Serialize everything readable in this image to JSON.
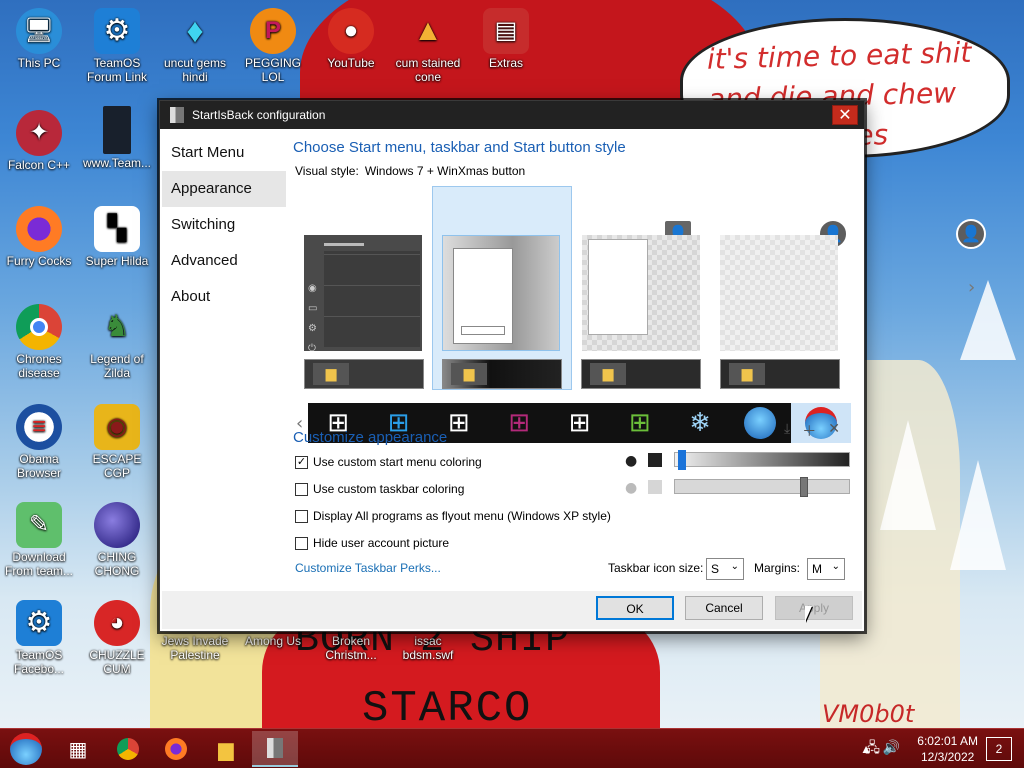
{
  "desktop": {
    "background_text": {
      "bubble": "it's time to eat shit and die and chew",
      "bubble_tail": "mes",
      "shirt_line1": "BORN 2 SHIP",
      "shirt_line2": "STARCO",
      "signature": "VM0b0t"
    },
    "icons": [
      {
        "label": "This PC",
        "icon": "computer-icon"
      },
      {
        "label": "TeamOS Forum Link",
        "icon": "gear-icon"
      },
      {
        "label": "uncut gems hindi",
        "icon": "diamond-icon"
      },
      {
        "label": "PEGGING LOL",
        "icon": "peggle-icon"
      },
      {
        "label": "YouTube",
        "icon": "angry-bird-icon"
      },
      {
        "label": "cum stained cone",
        "icon": "cone-icon"
      },
      {
        "label": "Extras",
        "icon": "archive-icon"
      },
      {
        "label": "Falcon C++",
        "icon": "falcon-icon"
      },
      {
        "label": "www.Team...",
        "icon": "document-icon"
      },
      {
        "label": "Furry Cocks",
        "icon": "firefox-icon"
      },
      {
        "label": "Super Hilda",
        "icon": "pixel-dog-icon"
      },
      {
        "label": "Chrones disease",
        "icon": "chrome-icon"
      },
      {
        "label": "Legend of Zilda",
        "icon": "link-sprite-icon"
      },
      {
        "label": "Obama Browser",
        "icon": "obama-logo-icon"
      },
      {
        "label": "ESCAPE CGP",
        "icon": "mahjong-icon"
      },
      {
        "label": "Download From team...",
        "icon": "notepad-icon"
      },
      {
        "label": "CHING CHONG",
        "icon": "bomb-icon"
      },
      {
        "label": "TeamOS Facebo...",
        "icon": "gear-icon"
      },
      {
        "label": "CHUZZLE CUM",
        "icon": "chuzzle-icon"
      },
      {
        "label": "Jews Invade Palestine",
        "icon": "game-icon"
      },
      {
        "label": "Among Us",
        "icon": "among-us-icon"
      },
      {
        "label": "Broken Christm...",
        "icon": "document-icon"
      },
      {
        "label": "issac bdsm.swf",
        "icon": "swf-icon"
      }
    ]
  },
  "window": {
    "title": "StartIsBack configuration",
    "close_symbol": "✕",
    "sidebar": [
      "Start Menu",
      "Appearance",
      "Switching",
      "Advanced",
      "About"
    ],
    "selected_nav": "Appearance",
    "heading": "Choose Start menu, taskbar and Start button style",
    "visual_style_label": "Visual style:",
    "visual_style_value": "Windows 7 + WinXmas button",
    "customize_heading": "Customize appearance",
    "options": [
      {
        "label": "Use custom start menu coloring",
        "checked": true
      },
      {
        "label": "Use custom taskbar coloring",
        "checked": false
      },
      {
        "label": "Display All programs as flyout menu (Windows XP style)",
        "checked": false
      },
      {
        "label": "Hide user account picture",
        "checked": false
      }
    ],
    "start_menu_color_level": 0.02,
    "taskbar_color_level": 0.75,
    "link": "Customize Taskbar Perks...",
    "icon_size_label": "Taskbar icon size:",
    "icon_size_value": "S",
    "margins_label": "Margins:",
    "margins_value": "M",
    "buttons": {
      "ok": "OK",
      "cancel": "Cancel",
      "apply": "Apply"
    },
    "start_buttons": [
      "windows-10-white",
      "windows-10-blue",
      "windows-10-outline",
      "windows-8-purple",
      "windows-10-flat",
      "windows-7-flag",
      "snowflake-icon",
      "windows-7-orb",
      "winxmas-orb"
    ]
  },
  "taskbar": {
    "time": "6:02:01 AM",
    "date": "12/3/2022",
    "notification_count": "2",
    "colors": {
      "bar": "#6d0d0d",
      "accent": "#0078d7"
    }
  }
}
